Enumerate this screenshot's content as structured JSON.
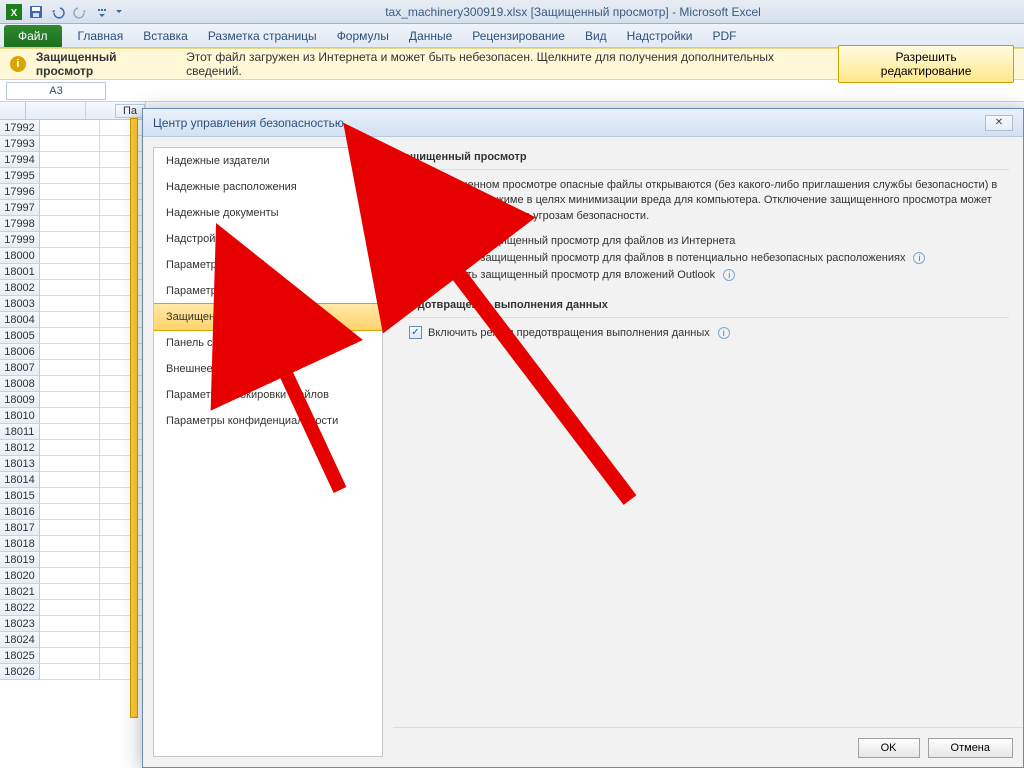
{
  "window": {
    "title": "tax_machinery300919.xlsx  [Защищенный просмотр]  -  Microsoft Excel"
  },
  "ribbon": {
    "file": "Файл",
    "tabs": [
      "Главная",
      "Вставка",
      "Разметка страницы",
      "Формулы",
      "Данные",
      "Рецензирование",
      "Вид",
      "Надстройки",
      "PDF"
    ]
  },
  "protected_view_bar": {
    "title": "Защищенный просмотр",
    "text": "Этот файл загружен из Интернета и может быть небезопасен. Щелкните для получения дополнительных сведений.",
    "button": "Разрешить редактирование"
  },
  "namebox": "A3",
  "col_partial_label": "Па",
  "rows": [
    17992,
    17993,
    17994,
    17995,
    17996,
    17997,
    17998,
    17999,
    18000,
    18001,
    18002,
    18003,
    18004,
    18005,
    18006,
    18007,
    18008,
    18009,
    18010,
    18011,
    18012,
    18013,
    18014,
    18015,
    18016,
    18017,
    18018,
    18019,
    18020,
    18021,
    18022,
    18023,
    18024,
    18025,
    18026
  ],
  "dialog": {
    "title": "Центр управления безопасностью",
    "nav": [
      "Надежные издатели",
      "Надежные расположения",
      "Надежные документы",
      "Надстройки",
      "Параметры ActiveX",
      "Параметры макросов",
      "Защищенный просмотр",
      "Панель сообщений",
      "Внешнее содержимое",
      "Параметры блокировки файлов",
      "Параметры конфиденциальности"
    ],
    "nav_selected_index": 6,
    "section1_title": "Защищенный просмотр",
    "section1_desc": "При защищенном просмотре опасные файлы открываются (без какого-либо приглашения службы безопасности) в ограниченном режиме в целях минимизации вреда для компьютера. Отключение защищенного просмотра может подвергнуть компьютер угрозам безопасности.",
    "chk1": "Включить защищенный просмотр для файлов из Интернета",
    "chk2": "Включить защищенный просмотр для файлов в потенциально небезопасных расположениях",
    "chk3": "Включить защищенный просмотр для вложений Outlook",
    "section2_title": "Предотвращение выполнения данных",
    "chk4": "Включить режим предотвращения выполнения данных",
    "ok": "OK",
    "cancel": "Отмена"
  }
}
